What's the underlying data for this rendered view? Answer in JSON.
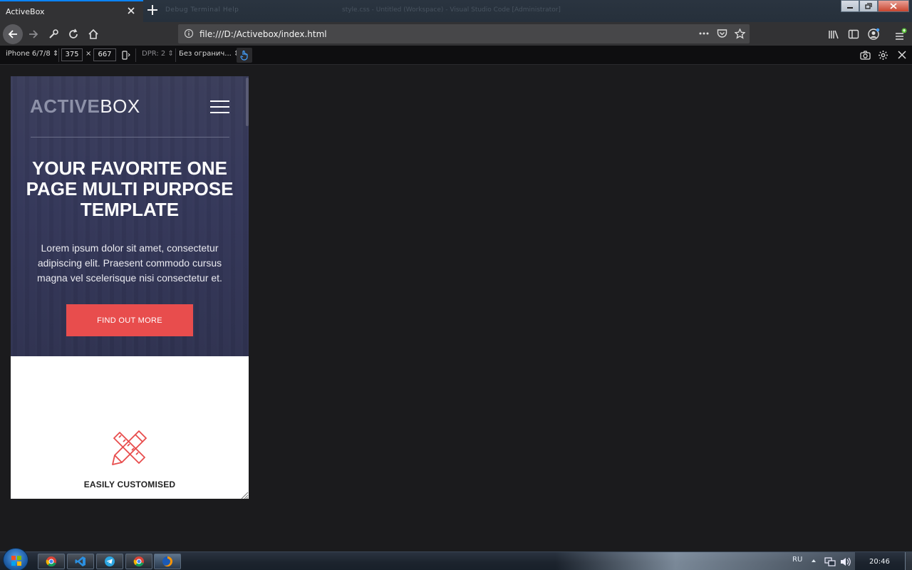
{
  "browser": {
    "tab_title": "ActiveBox",
    "background_tabs": "Debug   Terminal   Help",
    "window_title_faded": "style.css - Untitled (Workspace) - Visual Studio Code [Administrator]",
    "url": "file:///D:/Activebox/index.html"
  },
  "rdm": {
    "device": "iPhone 6/7/8",
    "width": "375",
    "times": "×",
    "height": "667",
    "dpr": "DPR: 2",
    "throttling": "Без огранич..."
  },
  "site": {
    "logo_strong": "ACTIVE",
    "logo_light": "BOX",
    "hero_title": "YOUR FAVORITE ONE PAGE MULTI PURPOSE TEMPLATE",
    "hero_text": "Lorem ipsum dolor sit amet, consectetur adipiscing elit. Praesent commodo cursus magna vel scelerisque nisi consectetur et.",
    "cta_label": "FIND OUT MORE",
    "feature_title": "EASILY CUSTOMISED",
    "accent_color": "#e84d4d"
  },
  "taskbar": {
    "language": "RU",
    "time": "20:46"
  }
}
